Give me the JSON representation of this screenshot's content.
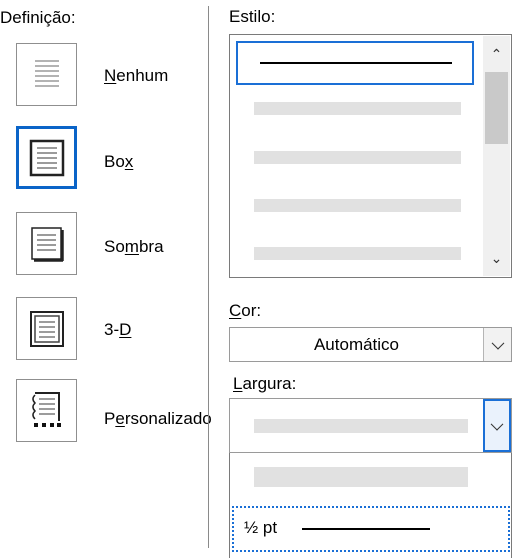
{
  "definicao": {
    "heading": "Definição:",
    "options": [
      {
        "label_pre": "",
        "label_u": "N",
        "label_post": "enhum",
        "selected": false,
        "icon": "border-none-icon"
      },
      {
        "label_pre": "Bo",
        "label_u": "x",
        "label_post": "",
        "selected": true,
        "icon": "border-box-icon"
      },
      {
        "label_pre": "So",
        "label_u": "m",
        "label_post": "bra",
        "selected": false,
        "icon": "border-shadow-icon"
      },
      {
        "label_pre": "3-",
        "label_u": "D",
        "label_post": "",
        "selected": false,
        "icon": "border-3d-icon"
      },
      {
        "label_pre": "P",
        "label_u": "e",
        "label_post": "rsonalizado",
        "selected": false,
        "icon": "border-custom-icon"
      }
    ]
  },
  "estilo": {
    "heading": "Estilo:"
  },
  "cor": {
    "label_u": "C",
    "label_post": "or:",
    "value": "Automático"
  },
  "largura": {
    "label_u": "L",
    "label_post": "argura:",
    "selected_value": "½ pt"
  },
  "colors": {
    "accent": "#0a64c8",
    "placeholder_bar": "#e1e1e1",
    "border": "#8f8f8f"
  }
}
